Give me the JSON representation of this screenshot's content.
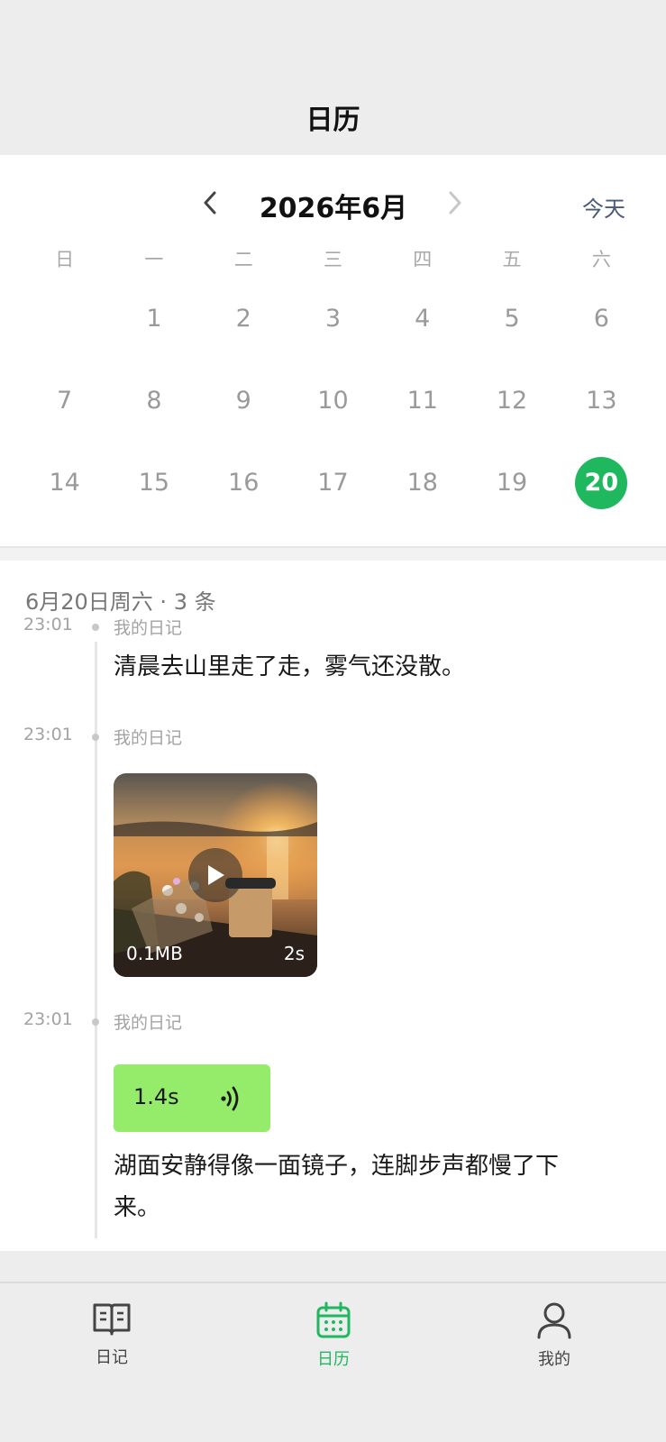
{
  "header": {
    "title": "日历"
  },
  "calendar": {
    "month_label": "2026年6月",
    "today_label": "今天",
    "weekdays": [
      "日",
      "一",
      "二",
      "三",
      "四",
      "五",
      "六"
    ],
    "weeks": [
      [
        "",
        "1",
        "2",
        "3",
        "4",
        "5",
        "6"
      ],
      [
        "7",
        "8",
        "9",
        "10",
        "11",
        "12",
        "13"
      ],
      [
        "14",
        "15",
        "16",
        "17",
        "18",
        "19",
        "20"
      ]
    ],
    "selected_day": "20",
    "accent_color": "#1fb85f"
  },
  "entries": {
    "date_heading": "6月20日周六 · 3 条",
    "items": [
      {
        "time": "23:01",
        "source": "我的日记",
        "text": "清晨去山里走了走，雾气还没散。"
      },
      {
        "time": "23:01",
        "source": "我的日记",
        "video": {
          "size": "0.1MB",
          "duration": "2s"
        }
      },
      {
        "time": "23:01",
        "source": "我的日记",
        "voice": {
          "duration": "1.4s"
        },
        "text_line1": "湖面安静得像一面镜子，连脚步声都慢了下",
        "text_line2": "来。"
      }
    ]
  },
  "tab_bar": {
    "tabs": [
      {
        "label": "日记",
        "icon": "book-icon"
      },
      {
        "label": "日历",
        "icon": "calendar-icon",
        "active": true
      },
      {
        "label": "我的",
        "icon": "person-icon"
      }
    ]
  }
}
